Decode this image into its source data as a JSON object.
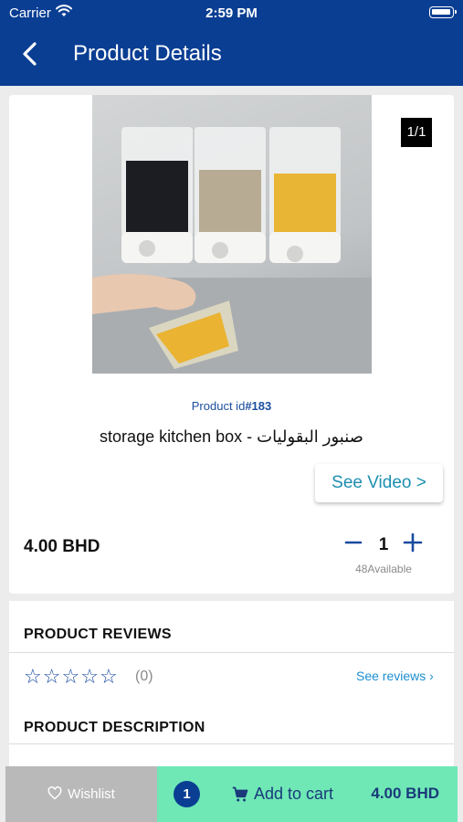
{
  "status_bar": {
    "carrier": "Carrier",
    "time": "2:59 PM"
  },
  "header": {
    "title": "Product Details"
  },
  "product": {
    "image_pager": "1/1",
    "id_label": "Product id",
    "id_value": "#183",
    "name": "storage kitchen box - صنبور البقوليات",
    "see_video_label": "See Video >",
    "price": "4.00 BHD",
    "quantity": "1",
    "availability": "48Available"
  },
  "reviews": {
    "heading": "PRODUCT REVIEWS",
    "rating": 0,
    "count_label": "(0)",
    "see_reviews_label": "See reviews ›"
  },
  "description": {
    "heading": "PRODUCT DESCRIPTION"
  },
  "bottom_bar": {
    "wishlist_label": "Wishlist",
    "cart_count": "1",
    "add_to_cart_label": "Add to cart",
    "total": "4.00 BHD"
  },
  "colors": {
    "header": "#0a3e93",
    "accent": "#1a4aa0",
    "cart_bar": "#6fe8b6",
    "wishlist_bar": "#b9b9b9"
  }
}
